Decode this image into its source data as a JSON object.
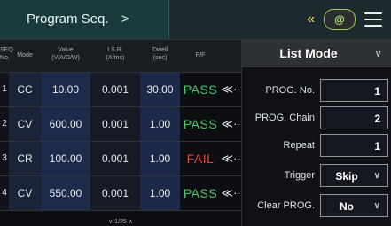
{
  "header": {
    "title": "Program Seq.",
    "back_chevron": ">",
    "double_arrow": "«",
    "badge_text": "@",
    "menu_icon": "hamburger"
  },
  "table": {
    "headers": {
      "seq": "SEQ\nNo.",
      "mode": "Mode",
      "value": "Value\n(V/A/Ω/W)",
      "isr": "I.S.R.\n(A/ms)",
      "dwell": "Dwell\n(sec)",
      "pf": "P/F"
    },
    "rows": [
      {
        "seq": "1",
        "mode": "CC",
        "value": "10.00",
        "isr": "0.001",
        "dwell": "30.00",
        "pf": "PASS",
        "arrow": "≪··"
      },
      {
        "seq": "2",
        "mode": "CV",
        "value": "600.00",
        "isr": "0.001",
        "dwell": "1.00",
        "pf": "PASS",
        "arrow": "≪··"
      },
      {
        "seq": "3",
        "mode": "CR",
        "value": "100.00",
        "isr": "0.001",
        "dwell": "1.00",
        "pf": "FAIL",
        "arrow": "≪··"
      },
      {
        "seq": "4",
        "mode": "CV",
        "value": "550.00",
        "isr": "0.001",
        "dwell": "1.00",
        "pf": "PASS",
        "arrow": "≪··"
      }
    ],
    "pager": "∨ 1/25 ∧"
  },
  "right": {
    "mode_label": "List Mode",
    "caret": "∨",
    "fields": {
      "prog_no_label": "PROG. No.",
      "prog_no_value": "1",
      "prog_chain_label": "PROG. Chain",
      "prog_chain_value": "2",
      "repeat_label": "Repeat",
      "repeat_value": "1",
      "trigger_label": "Trigger",
      "trigger_value": "Skip",
      "clear_label": "Clear PROG.",
      "clear_value": "No"
    }
  },
  "colors": {
    "pass": "#47cd6a",
    "fail": "#d94a45",
    "accent": "#ffd65a"
  }
}
